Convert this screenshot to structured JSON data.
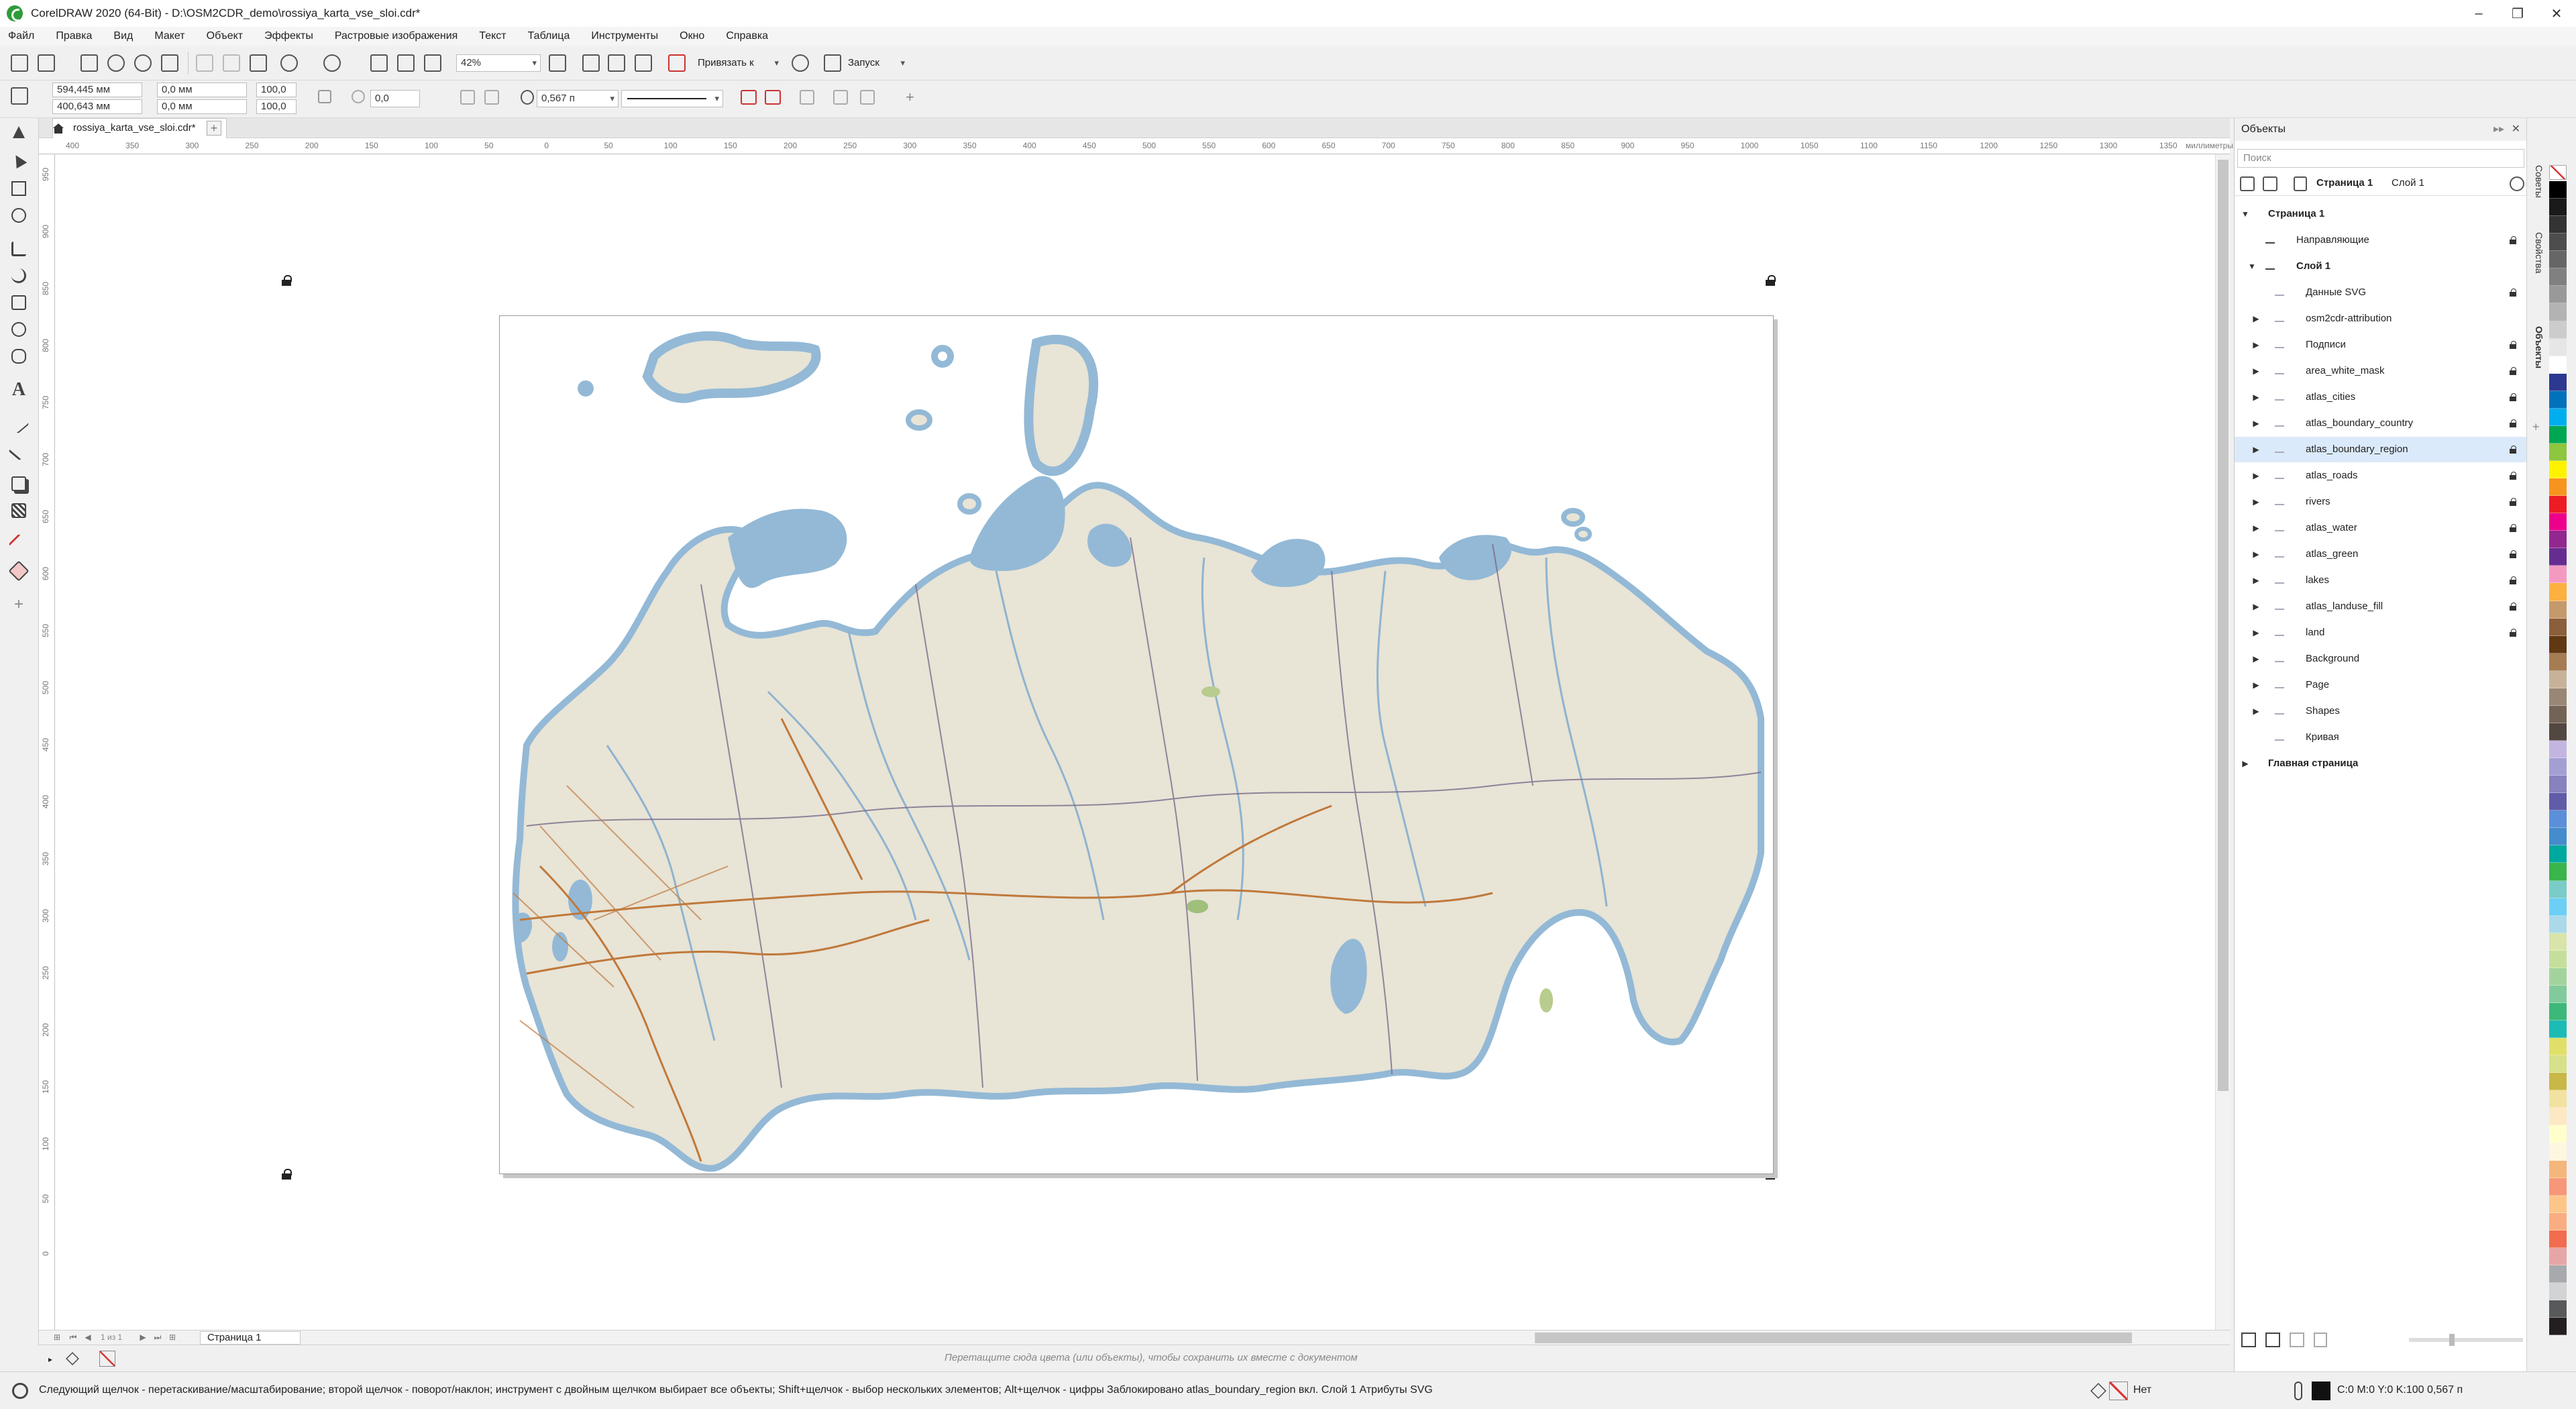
{
  "window": {
    "title": "CorelDRAW 2020 (64-Bit) - D:\\OSM2CDR_demo\\rossiya_karta_vse_sloi.cdr*"
  },
  "menu": [
    "Файл",
    "Правка",
    "Вид",
    "Макет",
    "Объект",
    "Эффекты",
    "Растровые изображения",
    "Текст",
    "Таблица",
    "Инструменты",
    "Окно",
    "Справка"
  ],
  "std_toolbar": {
    "zoom": "42%",
    "snap": "Привязать к",
    "launch": "Запуск"
  },
  "property_bar": {
    "x": "594,445 мм",
    "y": "400,643 мм",
    "w": "0,0 мм",
    "h": "0,0 мм",
    "scale_x": "100,0",
    "scale_y": "100,0",
    "rotation": "0,0",
    "outline_width": "0,567 п"
  },
  "document": {
    "tab_name": "rossiya_karta_vse_sloi.cdr*",
    "page_tab": "Страница 1",
    "page_counter": "1 из 1"
  },
  "ruler": {
    "unit": "миллиметры",
    "h_ticks": [
      "400",
      "350",
      "300",
      "250",
      "200",
      "150",
      "100",
      "50",
      "0",
      "50",
      "100",
      "150",
      "200",
      "250",
      "300",
      "350",
      "400",
      "450",
      "500",
      "550",
      "600",
      "650",
      "700",
      "750",
      "800",
      "850",
      "900",
      "950",
      "1000",
      "1050",
      "1100",
      "1150",
      "1200",
      "1250",
      "1300",
      "1350"
    ],
    "v_ticks": [
      "950",
      "900",
      "850",
      "800",
      "750",
      "700",
      "650",
      "600",
      "550",
      "500",
      "450",
      "400",
      "350",
      "300",
      "250",
      "200",
      "150",
      "100",
      "50",
      "0"
    ]
  },
  "colorbar": {
    "hint": "Перетащите сюда цвета (или объекты), чтобы сохранить их вместе с документом"
  },
  "status": {
    "hint": "Следующий щелчок - перетаскивание/масштабирование; второй щелчок - поворот/наклон; инструмент с двойным щелчком выбирает все объекты; Shift+щелчок - выбор нескольких элементов; Alt+щелчок - цифры",
    "info": "Заблокировано atlas_boundary_region вкл. Слой 1 Атрибуты SVG",
    "fill_none": "Нет",
    "outline": "C:0 M:0 Y:0 K:100  0,567 п"
  },
  "docker": {
    "title": "Объекты",
    "search_placeholder": "Поиск",
    "page_label": "Страница 1",
    "layer_label": "Слой 1",
    "tree": [
      {
        "label": "Страница 1",
        "level": 0,
        "expanded": true,
        "bold": true,
        "lock": false
      },
      {
        "label": "Направляющие",
        "level": 1,
        "expanded": false,
        "bold": false,
        "lock": true,
        "noarrow": true
      },
      {
        "label": "Слой 1",
        "level": 1,
        "expanded": true,
        "bold": true,
        "lock": false
      },
      {
        "label": "Данные SVG",
        "level": 2,
        "noarrow": true,
        "lock": true
      },
      {
        "label": "osm2cdr-attribution",
        "level": 2,
        "lock": false
      },
      {
        "label": "Подписи",
        "level": 2,
        "lock": true
      },
      {
        "label": "area_white_mask",
        "level": 2,
        "lock": true
      },
      {
        "label": "atlas_cities",
        "level": 2,
        "lock": true
      },
      {
        "label": "atlas_boundary_country",
        "level": 2,
        "lock": true
      },
      {
        "label": "atlas_boundary_region",
        "level": 2,
        "lock": true,
        "selected": true
      },
      {
        "label": "atlas_roads",
        "level": 2,
        "lock": true
      },
      {
        "label": "rivers",
        "level": 2,
        "lock": true
      },
      {
        "label": "atlas_water",
        "level": 2,
        "lock": true
      },
      {
        "label": "atlas_green",
        "level": 2,
        "lock": true
      },
      {
        "label": "lakes",
        "level": 2,
        "lock": true
      },
      {
        "label": "atlas_landuse_fill",
        "level": 2,
        "lock": true
      },
      {
        "label": "land",
        "level": 2,
        "lock": true
      },
      {
        "label": "Background",
        "level": 2,
        "lock": false
      },
      {
        "label": "Page",
        "level": 2,
        "lock": false
      },
      {
        "label": "Shapes",
        "level": 2,
        "lock": false
      },
      {
        "label": "Кривая",
        "level": 2,
        "noarrow": true,
        "lock": false
      },
      {
        "label": "Главная страница",
        "level": 0,
        "expanded": false,
        "bold": true,
        "lock": false
      }
    ]
  },
  "side_tabs": [
    "Советы",
    "Свойства",
    "Объекты"
  ],
  "palette": [
    "#000000",
    "#1a1a1a",
    "#333333",
    "#4d4d4d",
    "#666666",
    "#808080",
    "#999999",
    "#b3b3b3",
    "#cccccc",
    "#e6e6e6",
    "#ffffff",
    "#2b3990",
    "#0072bc",
    "#00aeef",
    "#00a651",
    "#8dc63f",
    "#fff200",
    "#f7941d",
    "#ed1c24",
    "#ec008c",
    "#92278f",
    "#662d91",
    "#f49ac1",
    "#fbb040",
    "#c49a6c",
    "#8b5e3c",
    "#603913",
    "#a67c52",
    "#c7b299",
    "#998675",
    "#736357",
    "#534741",
    "#c2b5e0",
    "#a39fd3",
    "#8781bd",
    "#605ca8",
    "#5b8fd9",
    "#448ccb",
    "#00a99d",
    "#39b54a",
    "#7accc8",
    "#6dcff6",
    "#abd9e9",
    "#d9e4aa",
    "#c4df9b",
    "#a3d39c",
    "#82ca9c",
    "#3cb878",
    "#1cbbb4",
    "#e0e068",
    "#d7e08a",
    "#c8b848",
    "#f2e2a0",
    "#fde8c4",
    "#ffffcc",
    "#fff6e0",
    "#f5b67c",
    "#f79679",
    "#fdc689",
    "#f9ad81",
    "#f26c4f",
    "#e6a6a6",
    "#a7a9ac",
    "#d1d3d4",
    "#58595b",
    "#231f20"
  ]
}
